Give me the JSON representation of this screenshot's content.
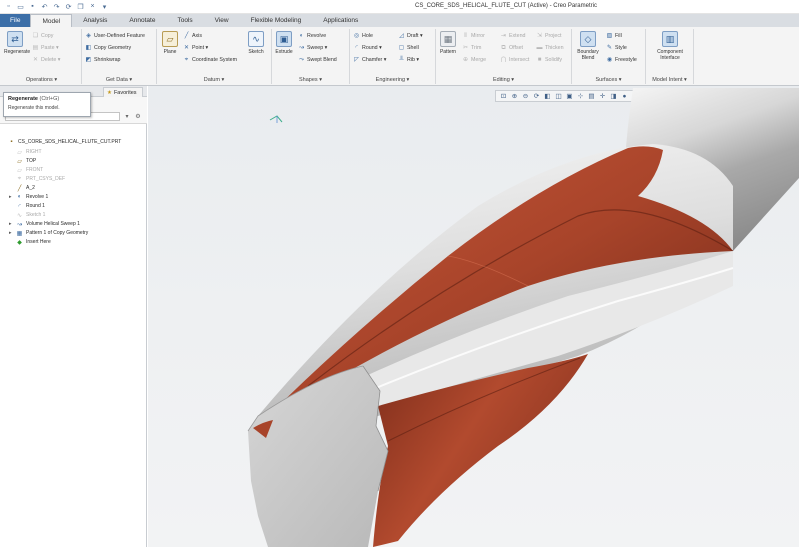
{
  "window": {
    "title": "CS_CORE_SDS_HELICAL_FLUTE_CUT (Active) - Creo Parametric"
  },
  "quick_access": [
    "new-icon",
    "open-icon",
    "save-icon",
    "undo-icon",
    "redo-icon",
    "regenerate-icon",
    "windows-icon",
    "close-icon",
    "customize-icon"
  ],
  "tabs": [
    {
      "label": "File",
      "key": "file"
    },
    {
      "label": "Model",
      "key": "model"
    },
    {
      "label": "Analysis",
      "key": "analysis"
    },
    {
      "label": "Annotate",
      "key": "annotate"
    },
    {
      "label": "Tools",
      "key": "tools"
    },
    {
      "label": "View",
      "key": "view"
    },
    {
      "label": "Flexible Modeling",
      "key": "flexible"
    },
    {
      "label": "Applications",
      "key": "applications"
    }
  ],
  "ribbon": {
    "operations": {
      "label": "Operations ▾",
      "regenerate": "Regenerate",
      "copy": "Copy",
      "paste": "Paste ▾",
      "delete": "Delete ▾"
    },
    "get_data": {
      "label": "Get Data ▾",
      "udf": "User-Defined Feature",
      "copy_geometry": "Copy Geometry",
      "shrinkwrap": "Shrinkwrap"
    },
    "datum": {
      "label": "Datum ▾",
      "plane": "Plane",
      "axis": "Axis",
      "point": "Point ▾",
      "csys": "Coordinate System",
      "sketch": "Sketch"
    },
    "shapes": {
      "label": "Shapes ▾",
      "extrude": "Extrude",
      "revolve": "Revolve",
      "sweep": "Sweep ▾",
      "swept_blend": "Swept Blend"
    },
    "engineering": {
      "label": "Engineering ▾",
      "hole": "Hole",
      "round": "Round ▾",
      "chamfer": "Chamfer ▾",
      "draft": "Draft ▾",
      "shell": "Shell",
      "rib": "Rib ▾"
    },
    "editing": {
      "label": "Editing ▾",
      "pattern": "Pattern",
      "mirror": "Mirror",
      "trim": "Trim",
      "merge": "Merge",
      "extend": "Extend",
      "offset": "Offset",
      "intersect": "Intersect",
      "project": "Project",
      "thicken": "Thicken",
      "solidify": "Solidify"
    },
    "surfaces": {
      "label": "Surfaces ▾",
      "boundary_blend": "Boundary Blend",
      "fill": "Fill",
      "style": "Style",
      "freestyle": "Freestyle"
    },
    "model_intent": {
      "label": "Model Intent ▾",
      "component_interface": "Component Interface"
    }
  },
  "panel": {
    "favorites_tab": "Favorites"
  },
  "tooltip": {
    "title": "Regenerate",
    "shortcut": "(Ctrl+G)",
    "description": "Regenerate this model."
  },
  "tree": [
    {
      "label": "CS_CORE_SDS_HELICAL_FLUTE_CUT.PRT",
      "icon": "part-icon",
      "dim": false
    },
    {
      "label": "RIGHT",
      "icon": "datum-plane-icon",
      "dim": true
    },
    {
      "label": "TOP",
      "icon": "datum-plane-icon",
      "dim": false
    },
    {
      "label": "FRONT",
      "icon": "datum-plane-icon",
      "dim": true
    },
    {
      "label": "PRT_CSYS_DEF",
      "icon": "csys-icon",
      "dim": true
    },
    {
      "label": "A_2",
      "icon": "axis-icon",
      "dim": false
    },
    {
      "label": "Revolve 1",
      "icon": "revolve-icon",
      "dim": false
    },
    {
      "label": "Round 1",
      "icon": "round-icon",
      "dim": false
    },
    {
      "label": "Sketch 1",
      "icon": "sketch-icon",
      "dim": true
    },
    {
      "label": "Volume Helical Sweep 1",
      "icon": "helical-sweep-icon",
      "dim": false
    },
    {
      "label": "Pattern 1 of Copy Geometry",
      "icon": "pattern-icon",
      "dim": false
    },
    {
      "label": "Insert Here",
      "icon": "insert-here-icon",
      "dim": false
    }
  ],
  "view_toolbar": [
    "refit-icon",
    "zoom-in-icon",
    "zoom-out-icon",
    "repaint-icon",
    "display-style-icon",
    "saved-orientations-icon",
    "view-manager-icon",
    "datum-display-icon",
    "annotation-display-icon",
    "spin-center-icon",
    "section-icon",
    "appearance-icon",
    "perspective-icon"
  ],
  "colors": {
    "file_tab": "#3c6fa8",
    "flute_copper": "#a8442a",
    "body_grey": "#c8c8c8"
  }
}
